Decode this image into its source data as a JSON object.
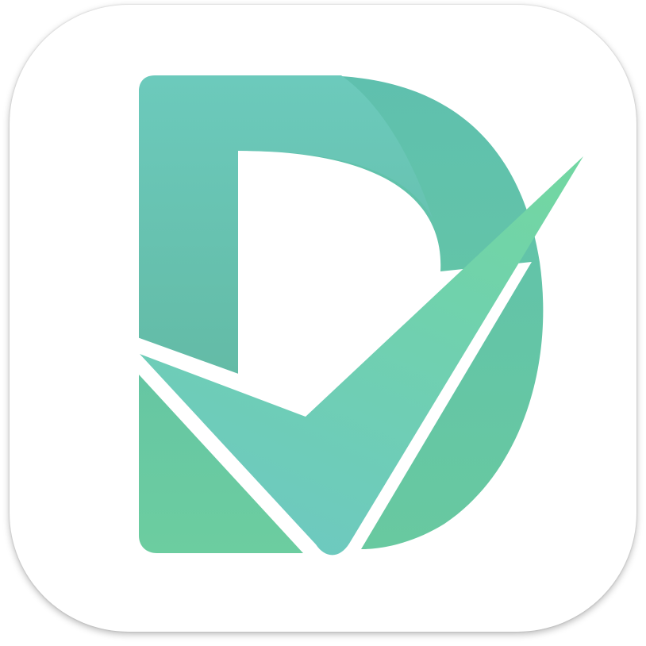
{
  "app_icon": {
    "logo_letter": "D",
    "icon": "d-checkmark-logo-icon",
    "colors": {
      "background": "#ffffff",
      "teal_light": "#6fcbbb",
      "teal_mid": "#62c1ae",
      "teal_dark": "#5bbfa9",
      "green": "#6ccda3",
      "check_top": "#6fd3a5",
      "check_bottom": "#6ccbc0"
    }
  }
}
